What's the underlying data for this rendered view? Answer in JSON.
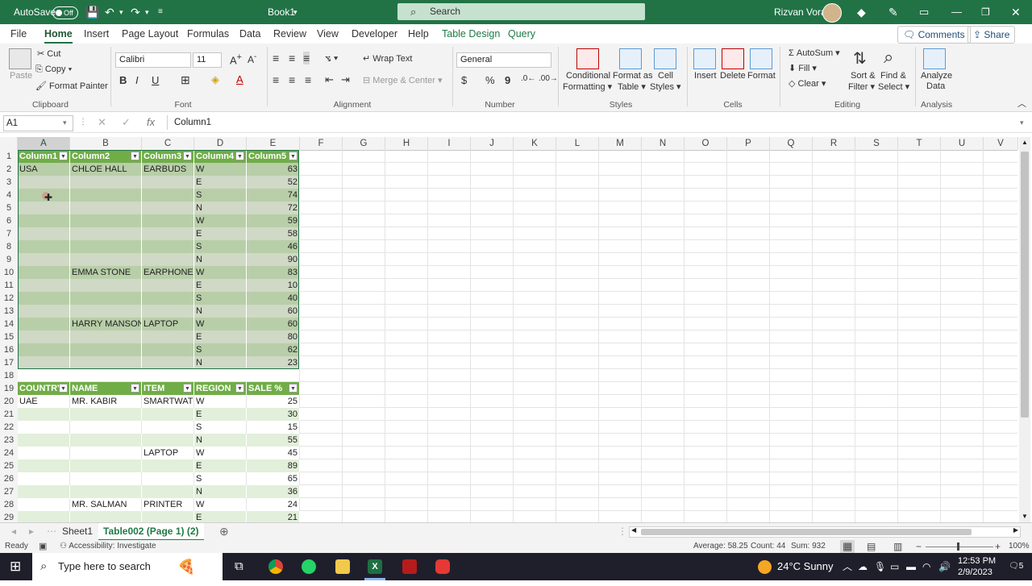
{
  "titlebar": {
    "autosave_label": "AutoSave",
    "autosave_state": "Off",
    "doc_title": "Book1",
    "search_placeholder": "Search",
    "user_name": "Rizvan Vora"
  },
  "menu_tabs": [
    "File",
    "Home",
    "Insert",
    "Page Layout",
    "Formulas",
    "Data",
    "Review",
    "View",
    "Developer",
    "Help",
    "Table Design",
    "Query"
  ],
  "active_tab": "Home",
  "actions": {
    "comments": "Comments",
    "share": "Share"
  },
  "ribbon": {
    "clipboard": {
      "paste": "Paste",
      "cut": "Cut",
      "copy": "Copy",
      "format_painter": "Format Painter",
      "group": "Clipboard"
    },
    "font": {
      "name": "Calibri",
      "size": "11",
      "group": "Font",
      "bold": "B",
      "italic": "I",
      "underline": "U"
    },
    "alignment": {
      "wrap": "Wrap Text",
      "merge": "Merge & Center",
      "group": "Alignment"
    },
    "number": {
      "format": "General",
      "currency": "$",
      "percent": "%",
      "comma": "9",
      "group": "Number"
    },
    "styles": {
      "cond_1": "Conditional",
      "cond_2": "Formatting",
      "fat_1": "Format as",
      "fat_2": "Table",
      "cs_1": "Cell",
      "cs_2": "Styles",
      "group": "Styles"
    },
    "cells": {
      "insert": "Insert",
      "delete": "Delete",
      "format": "Format",
      "group": "Cells"
    },
    "editing": {
      "autosum": "AutoSum",
      "fill": "Fill",
      "clear": "Clear",
      "sort_1": "Sort &",
      "sort_2": "Filter",
      "find_1": "Find &",
      "find_2": "Select",
      "group": "Editing"
    },
    "analysis": {
      "ad_1": "Analyze",
      "ad_2": "Data",
      "group": "Analysis"
    }
  },
  "formula_bar": {
    "name_box": "A1",
    "fx": "fx",
    "content": "Column1"
  },
  "columns": [
    "A",
    "B",
    "C",
    "D",
    "E",
    "F",
    "G",
    "H",
    "I",
    "J",
    "K",
    "L",
    "M",
    "N",
    "O",
    "P",
    "Q",
    "R",
    "S",
    "T",
    "U",
    "V"
  ],
  "rows": [
    "1",
    "2",
    "3",
    "4",
    "5",
    "6",
    "7",
    "8",
    "9",
    "10",
    "11",
    "12",
    "13",
    "14",
    "15",
    "16",
    "17",
    "18",
    "19",
    "20",
    "21",
    "22",
    "23",
    "24",
    "25",
    "26",
    "27",
    "28",
    "29"
  ],
  "table1": {
    "headers": [
      "Column1",
      "Column2",
      "Column3",
      "Column4",
      "Column5"
    ],
    "rows": [
      [
        "USA",
        "CHLOE HALL",
        "EARBUDS",
        "W",
        "63"
      ],
      [
        "",
        "",
        "",
        "E",
        "52"
      ],
      [
        "",
        "",
        "",
        "S",
        "74"
      ],
      [
        "",
        "",
        "",
        "N",
        "72"
      ],
      [
        "",
        "",
        "",
        "W",
        "59"
      ],
      [
        "",
        "",
        "",
        "E",
        "58"
      ],
      [
        "",
        "",
        "",
        "S",
        "46"
      ],
      [
        "",
        "",
        "",
        "N",
        "90"
      ],
      [
        "",
        "EMMA STONE",
        "EARPHONES",
        "W",
        "83"
      ],
      [
        "",
        "",
        "",
        "E",
        "10"
      ],
      [
        "",
        "",
        "",
        "S",
        "40"
      ],
      [
        "",
        "",
        "",
        "N",
        "60"
      ],
      [
        "",
        "HARRY MANSON",
        "LAPTOP",
        "W",
        "60"
      ],
      [
        "",
        "",
        "",
        "E",
        "80"
      ],
      [
        "",
        "",
        "",
        "S",
        "62"
      ],
      [
        "",
        "",
        "",
        "N",
        "23"
      ]
    ]
  },
  "table2": {
    "headers": [
      "COUNTRY",
      "NAME",
      "ITEM",
      "REGION",
      "SALE %"
    ],
    "rows": [
      [
        "UAE",
        "MR. KABIR",
        "SMARTWATC",
        "W",
        "25"
      ],
      [
        "",
        "",
        "",
        "E",
        "30"
      ],
      [
        "",
        "",
        "",
        "S",
        "15"
      ],
      [
        "",
        "",
        "",
        "N",
        "55"
      ],
      [
        "",
        "",
        "LAPTOP",
        "W",
        "45"
      ],
      [
        "",
        "",
        "",
        "E",
        "89"
      ],
      [
        "",
        "",
        "",
        "S",
        "65"
      ],
      [
        "",
        "",
        "",
        "N",
        "36"
      ],
      [
        "",
        "MR. SALMAN",
        "PRINTER",
        "W",
        "24"
      ],
      [
        "",
        "",
        "",
        "E",
        "21"
      ]
    ]
  },
  "sheets": [
    "Sheet1",
    "Table002 (Page 1) (2)"
  ],
  "status": {
    "ready": "Ready",
    "accessibility": "Accessibility: Investigate",
    "average": "Average: 58.25",
    "count": "Count: 44",
    "sum": "Sum: 932",
    "zoom": "100%"
  },
  "taskbar": {
    "search_placeholder": "Type here to search",
    "weather": "24°C  Sunny",
    "time": "12:53 PM",
    "date": "2/9/2023",
    "notif": "5"
  },
  "colors": {
    "excel_green": "#217346",
    "table_header": "#70ad47",
    "taskbar": "#1f1f2b"
  }
}
